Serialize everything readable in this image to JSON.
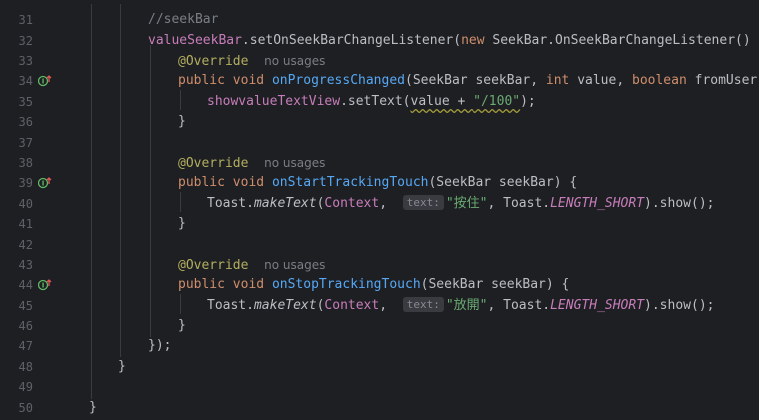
{
  "colors": {
    "background": "#1e1f22",
    "keyword": "#cf8e6d",
    "method": "#56a8f5",
    "string": "#6aab73",
    "annotation": "#b3ae60",
    "field": "#c77dbb",
    "comment": "#7a7e85"
  },
  "lines": [
    {
      "num": "31",
      "comment": "//seekBar"
    },
    {
      "num": "32",
      "field": "valueSeekBar",
      "t1": ".setOnSeekBarChangeListener(",
      "kw": "new",
      "t2": " SeekBar.OnSeekBarChangeListener() {"
    },
    {
      "num": "33",
      "anno": "@Override",
      "hint": "no usages"
    },
    {
      "num": "34",
      "kw1": "public",
      "kw2": "void",
      "fn": "onProgressChanged",
      "t1": "(SeekBar seekBar, ",
      "kw3": "int",
      "t2": " value, ",
      "kw4": "boolean",
      "t3": " fromUser) {",
      "icon": "override-gutter-icon"
    },
    {
      "num": "35",
      "field": "showvalueTextView",
      "t1": ".setText(",
      "squiggle": "value + ",
      "str": "\"/100\"",
      "t2": ");"
    },
    {
      "num": "36",
      "t1": "}"
    },
    {
      "num": "37"
    },
    {
      "num": "38",
      "anno": "@Override",
      "hint": "no usages"
    },
    {
      "num": "39",
      "kw1": "public",
      "kw2": "void",
      "fn": "onStartTrackingTouch",
      "t1": "(SeekBar seekBar) {",
      "icon": "override-gutter-icon"
    },
    {
      "num": "40",
      "t1": "Toast.",
      "static": "makeText",
      "t2": "(",
      "field": "Context",
      "t3": ", ",
      "inlay": "text:",
      "str": "\"按住\"",
      "t4": ", Toast.",
      "const": "LENGTH_SHORT",
      "t5": ").show();"
    },
    {
      "num": "41",
      "t1": "}"
    },
    {
      "num": "42"
    },
    {
      "num": "43",
      "anno": "@Override",
      "hint": "no usages"
    },
    {
      "num": "44",
      "kw1": "public",
      "kw2": "void",
      "fn": "onStopTrackingTouch",
      "t1": "(SeekBar seekBar) {",
      "icon": "override-gutter-icon"
    },
    {
      "num": "45",
      "t1": "Toast.",
      "static": "makeText",
      "t2": "(",
      "field": "Context",
      "t3": ", ",
      "inlay": "text:",
      "str": "\"放開\"",
      "t4": ", Toast.",
      "const": "LENGTH_SHORT",
      "t5": ").show();"
    },
    {
      "num": "46",
      "t1": "}"
    },
    {
      "num": "47",
      "t1": "});"
    },
    {
      "num": "48",
      "t1": "}"
    },
    {
      "num": "49"
    },
    {
      "num": "50",
      "t1": "}"
    }
  ]
}
